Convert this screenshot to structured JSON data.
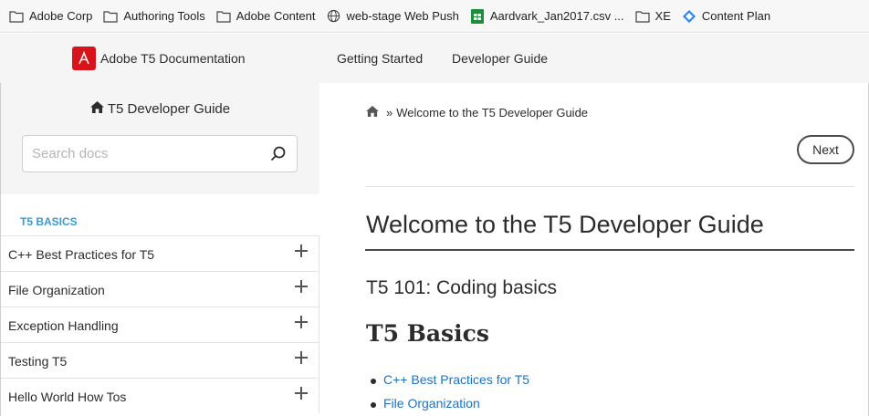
{
  "bookmarks": [
    {
      "label": "Adobe Corp",
      "icon": "folder-icon"
    },
    {
      "label": "Authoring Tools",
      "icon": "folder-icon"
    },
    {
      "label": "Adobe Content",
      "icon": "folder-icon"
    },
    {
      "label": "web-stage Web Push",
      "icon": "globe-icon"
    },
    {
      "label": "Aardvark_Jan2017.csv ...",
      "icon": "sheets-icon"
    },
    {
      "label": "XE",
      "icon": "folder-icon"
    },
    {
      "label": "Content Plan",
      "icon": "diamond-icon"
    }
  ],
  "header": {
    "brand": "Adobe T5 Documentation",
    "nav": [
      "Getting Started",
      "Developer Guide"
    ]
  },
  "sidebar": {
    "title": "T5 Developer Guide",
    "search_placeholder": "Search docs",
    "section": "T5 BASICS",
    "items": [
      {
        "label": "C++ Best Practices for T5"
      },
      {
        "label": "File Organization"
      },
      {
        "label": "Exception Handling"
      },
      {
        "label": "Testing T5"
      },
      {
        "label": "Hello World How Tos"
      }
    ]
  },
  "main": {
    "breadcrumb": "Welcome to the T5 Developer Guide",
    "breadcrumb_sep": "»",
    "next_label": "Next",
    "title": "Welcome to the T5 Developer Guide",
    "subtitle": "T5 101: Coding basics",
    "heading": "T5 Basics",
    "links": [
      "C++ Best Practices for T5",
      "File Organization"
    ]
  },
  "colors": {
    "brand_red": "#d7141a",
    "section_blue": "#3b9bd2",
    "link_blue": "#1a73c4"
  }
}
